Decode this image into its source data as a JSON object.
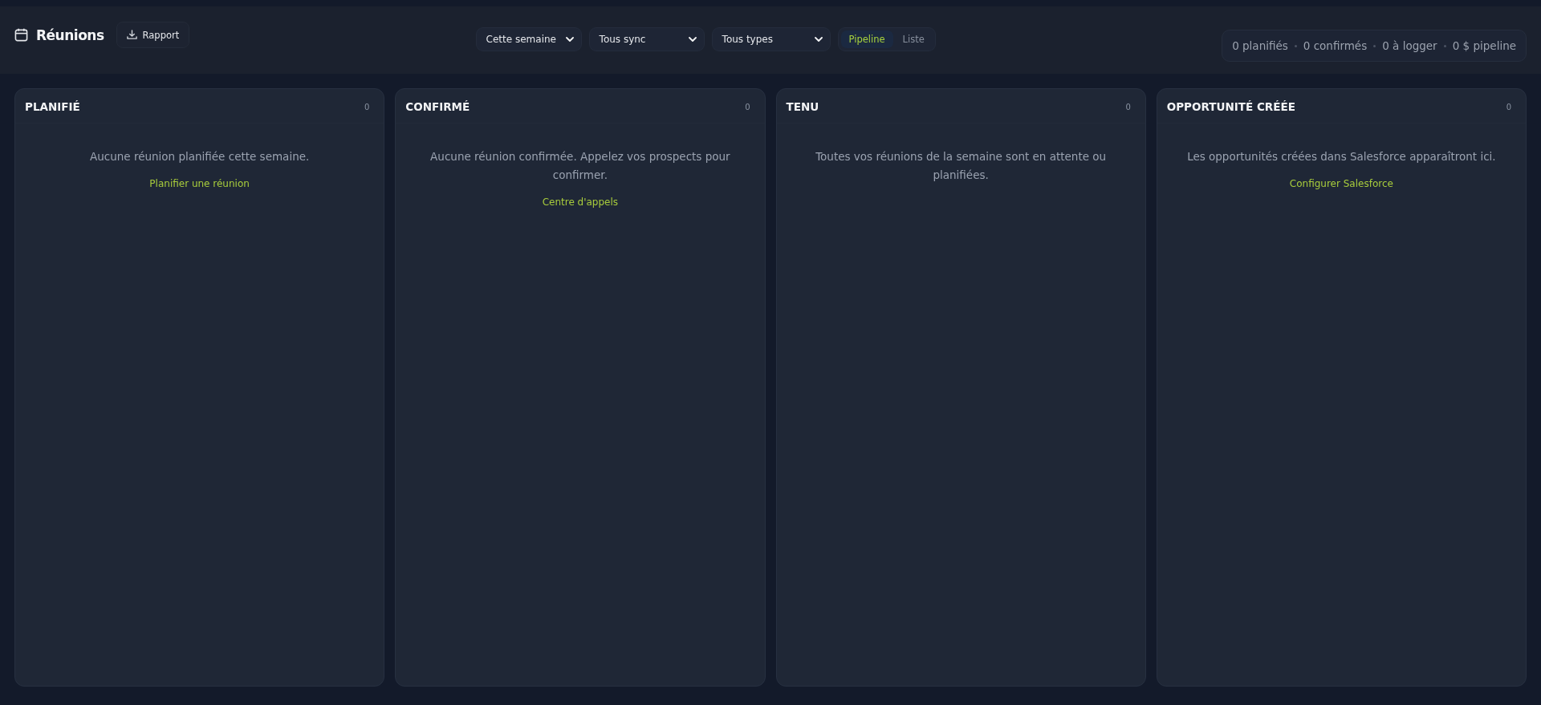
{
  "header": {
    "title": "Réunions",
    "report_button": "Rapport"
  },
  "filters": [
    {
      "value": "Cette semaine"
    },
    {
      "value": "Tous sync"
    },
    {
      "value": "Tous types"
    }
  ],
  "view_toggle": [
    {
      "label": "Pipeline",
      "selected": true
    },
    {
      "label": "Liste",
      "selected": false
    }
  ],
  "summary": [
    "0 planifiés",
    "0 confirmés",
    "0 à logger",
    "0 $ pipeline"
  ],
  "columns": [
    {
      "title": "PLANIFIÉ",
      "count": "0",
      "empty_text": "Aucune réunion planifiée cette semaine.",
      "action": "Planifier une réunion"
    },
    {
      "title": "CONFIRMÉ",
      "count": "0",
      "empty_text": "Aucune réunion confirmée. Appelez vos prospects pour confirmer.",
      "action": "Centre d'appels"
    },
    {
      "title": "TENU",
      "count": "0",
      "empty_text": "Toutes vos réunions de la semaine sont en attente ou planifiées."
    },
    {
      "title": "OPPORTUNITÉ CRÉÉE",
      "count": "0",
      "empty_text": "Les opportunités créées dans Salesforce apparaîtront ici.",
      "action": "Configurer Salesforce"
    }
  ]
}
